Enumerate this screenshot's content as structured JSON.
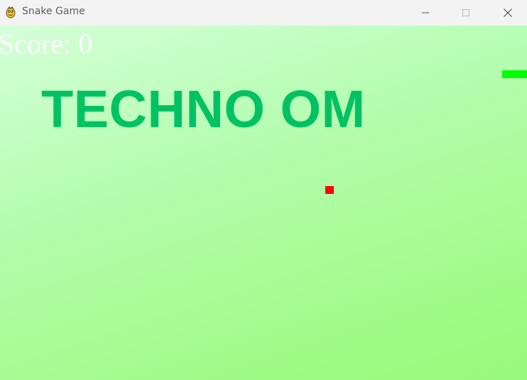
{
  "window": {
    "title": "Snake Game",
    "icon": "pygame-snake-icon",
    "controls": [
      "minimize-icon",
      "maximize-icon",
      "close-icon"
    ]
  },
  "game": {
    "score_text": "Score: 0",
    "score_value": 0,
    "brand_text": "TECHNO OM",
    "colors": {
      "background_top": "#d4ffd8",
      "background_bottom": "#98f97a",
      "score": "#ffffff",
      "brand": "#00c263",
      "snake": "#00ff00",
      "food": "#ff0000"
    }
  }
}
